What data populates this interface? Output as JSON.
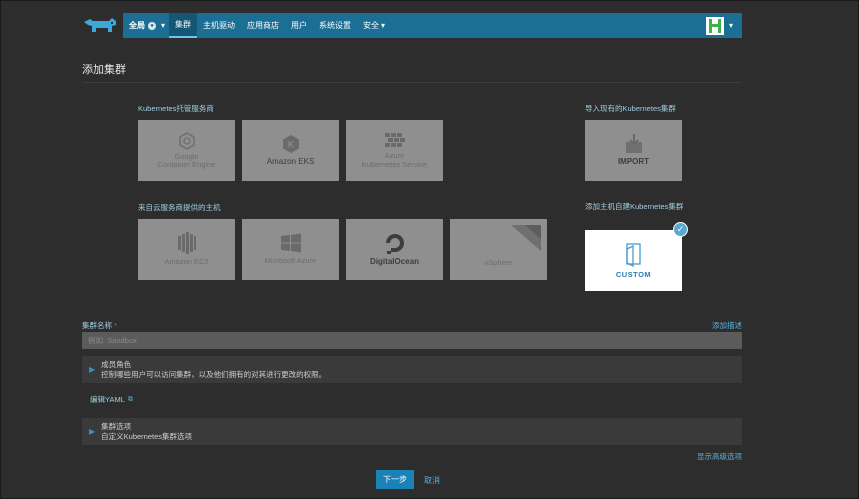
{
  "nav": {
    "scope": "全局",
    "items": [
      "集群",
      "主机驱动",
      "应用商店",
      "用户",
      "系统设置"
    ],
    "security": "安全"
  },
  "page": {
    "title": "添加集群"
  },
  "sections": {
    "hosted": "Kubernetes托管服务商",
    "import": "导入现有的Kubernetes集群",
    "cloud": "来自云服务商提供的主机",
    "custom": "添加主机自建Kubernetes集群"
  },
  "hosted_tiles": [
    {
      "icon": "google-container-engine-icon",
      "label": "Google\nContainer Engine"
    },
    {
      "icon": "amazon-eks-icon",
      "label": "Amazon EKS"
    },
    {
      "icon": "azure-kubernetes-icon",
      "label": "Azure\nKubernetes Service"
    }
  ],
  "import_tile": {
    "icon": "import-icon",
    "label": "IMPORT"
  },
  "cloud_tiles": [
    {
      "icon": "amazon-ec2-icon",
      "label": "Amazon EC2"
    },
    {
      "icon": "microsoft-azure-icon",
      "label": "Microsoft Azure"
    },
    {
      "icon": "digitalocean-icon",
      "label": "DigitalOcean"
    },
    {
      "icon": "vsphere-icon",
      "label": "vSphere"
    }
  ],
  "custom_tile": {
    "icon": "custom-icon",
    "label": "CUSTOM",
    "selected": true
  },
  "form": {
    "cluster_name_label": "集群名称",
    "required_mark": "*",
    "add_description": "添加描述",
    "cluster_name_placeholder": "例如: Sandbox",
    "cluster_name_value": ""
  },
  "members": {
    "title": "成员角色",
    "subtitle": "控制哪些用户可以访问集群，以及他们拥有的对其进行更改的权限。"
  },
  "edit_yaml": "编辑YAML",
  "cluster_options": {
    "title": "集群选项",
    "subtitle": "自定义Kubernetes集群选项"
  },
  "show_advanced": "显示高级选项",
  "buttons": {
    "next": "下一步",
    "cancel": "取消"
  },
  "colors": {
    "nav": "#1b6e94",
    "accent": "#56b3dc",
    "primary_button": "#1b82b8",
    "background": "#2d2d2d"
  }
}
